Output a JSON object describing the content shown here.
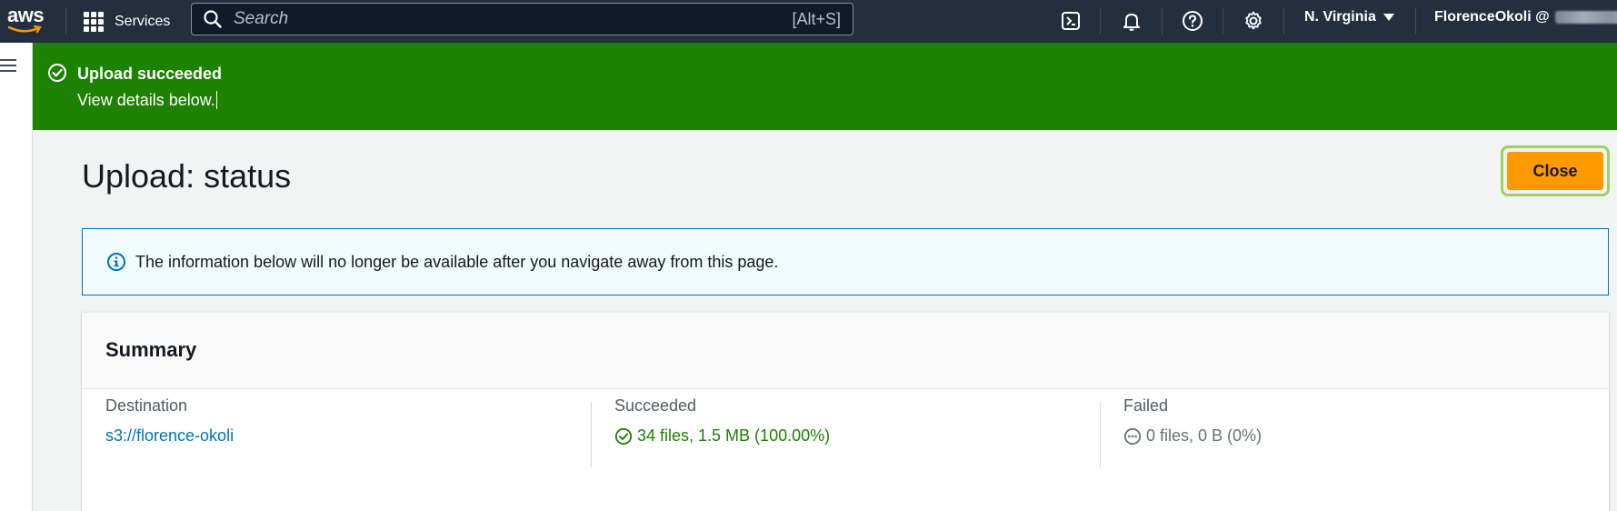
{
  "topnav": {
    "logo_text": "aws",
    "services_label": "Services",
    "search_placeholder": "Search",
    "search_shortcut": "[Alt+S]",
    "region_label": "N. Virginia",
    "account_label": "FlorenceOkoli @"
  },
  "flash": {
    "title": "Upload succeeded",
    "message": "View details below."
  },
  "page": {
    "title": "Upload: status",
    "close_label": "Close"
  },
  "info_alert": {
    "text": "The information below will no longer be available after you navigate away from this page."
  },
  "summary": {
    "title": "Summary",
    "destination": {
      "label": "Destination",
      "value": "s3://florence-okoli"
    },
    "succeeded": {
      "label": "Succeeded",
      "value": "34 files, 1.5 MB (100.00%)"
    },
    "failed": {
      "label": "Failed",
      "value": "0 files, 0 B (0%)"
    }
  },
  "colors": {
    "nav_bg": "#232f3e",
    "flash_success": "#1d8102",
    "primary_button": "#ff9900",
    "link": "#0073bb",
    "info_border": "#0073bb"
  },
  "icons": [
    "apps-grid-icon",
    "search-icon",
    "cloudshell-icon",
    "bell-icon",
    "help-icon",
    "settings-icon",
    "hamburger-menu-icon",
    "success-check-icon",
    "info-icon",
    "failed-pending-icon"
  ]
}
